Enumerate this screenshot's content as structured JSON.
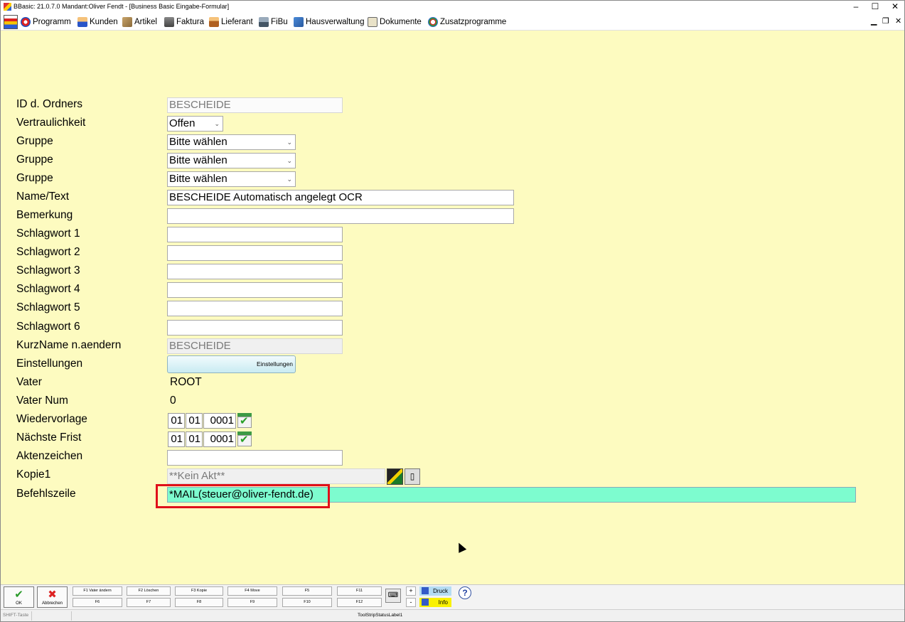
{
  "window": {
    "title": "BBasic: 21.0.7.0 Mandant:Oliver Fendt  - [Business Basic Eingabe-Formular]",
    "minimize": "–",
    "maximize": "☐",
    "close": "✕"
  },
  "menu": {
    "items": [
      {
        "label": "Programm",
        "icon": "programm-icon"
      },
      {
        "label": "Kunden",
        "icon": "kunden-icon"
      },
      {
        "label": "Artikel",
        "icon": "artikel-icon"
      },
      {
        "label": "Faktura",
        "icon": "faktura-icon"
      },
      {
        "label": "Lieferant",
        "icon": "lieferant-icon"
      },
      {
        "label": "FiBu",
        "icon": "fibu-icon"
      },
      {
        "label": "Hausverwaltung",
        "icon": "hausverwaltung-icon"
      },
      {
        "label": "Dokumente",
        "icon": "dokumente-icon"
      },
      {
        "label": "Zusatzprogramme",
        "icon": "zusatzprogramme-icon"
      }
    ],
    "mdi_min": "▁",
    "mdi_restore": "❐",
    "mdi_close": "✕"
  },
  "form": {
    "labels": {
      "id_ordner": "ID d. Ordners",
      "vertraulichkeit": "Vertraulichkeit",
      "gruppe1": "Gruppe",
      "gruppe2": "Gruppe",
      "gruppe3": "Gruppe",
      "name_text": "Name/Text",
      "bemerkung": "Bemerkung",
      "schlagwort1": "Schlagwort 1",
      "schlagwort2": "Schlagwort 2",
      "schlagwort3": "Schlagwort 3",
      "schlagwort4": "Schlagwort 4",
      "schlagwort5": "Schlagwort 5",
      "schlagwort6": "Schlagwort 6",
      "kurzname": "KurzName n.aendern",
      "einstellungen": "Einstellungen",
      "vater": "Vater",
      "vater_num": "Vater Num",
      "wiedervorlage": "Wiedervorlage",
      "naechste_frist": "Nächste Frist",
      "aktenzeichen": "Aktenzeichen",
      "kopie1": "Kopie1",
      "befehlszeile": "Befehlszeile"
    },
    "values": {
      "id_ordner": "BESCHEIDE",
      "vertraulichkeit": "Offen",
      "gruppe1": "Bitte wählen",
      "gruppe2": "Bitte wählen",
      "gruppe3": "Bitte wählen",
      "name_text": "BESCHEIDE Automatisch angelegt OCR",
      "bemerkung": "",
      "schlagwort1": "",
      "schlagwort2": "",
      "schlagwort3": "",
      "schlagwort4": "",
      "schlagwort5": "",
      "schlagwort6": "",
      "kurzname": "BESCHEIDE",
      "einstellungen_button": "Einstellungen",
      "vater": "ROOT",
      "vater_num": "0",
      "wiedervorlage": {
        "day": "01",
        "month": "01",
        "year": "0001"
      },
      "naechste_frist": {
        "day": "01",
        "month": "01",
        "year": "0001"
      },
      "aktenzeichen": "",
      "kopie1": "**Kein Akt**",
      "befehlszeile": "*MAIL(steuer@oliver-fendt.de)"
    }
  },
  "toolbar": {
    "ok": "OK",
    "abbrechen": "Abbrechen",
    "fkeys_top": [
      "F1 Vater ändern",
      "F2 Löschen",
      "F3 Kopie",
      "F4 Move",
      "F5",
      "F11"
    ],
    "fkeys_bottom": [
      "F6",
      "F7",
      "F8",
      "F9",
      "F10",
      "F12"
    ],
    "plus": "+",
    "minus": "-",
    "druck": "Druck",
    "info": "Info",
    "help": "?"
  },
  "statusbar": {
    "left": "SHIFT-Taste",
    "center": "ToolStripStatusLabel1"
  }
}
